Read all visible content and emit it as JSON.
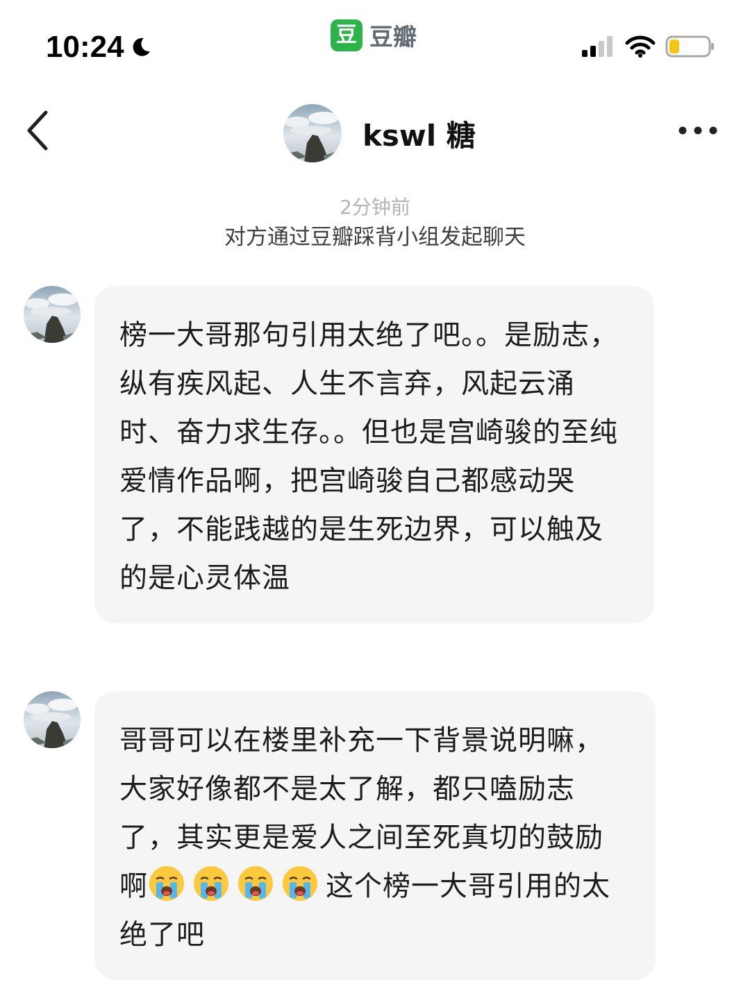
{
  "status_bar": {
    "time": "10:24",
    "app_logo_char": "豆",
    "app_name": "豆瓣",
    "icons": [
      "moon-icon",
      "signal-icon",
      "wifi-icon",
      "battery-icon"
    ],
    "battery_level": 0.25,
    "battery_color": "#f5c518"
  },
  "nav": {
    "title": "kswl 糖",
    "icons": [
      "back-arrow-icon",
      "more-icon"
    ]
  },
  "notice": {
    "time": "2分钟前",
    "text": "对方通过豆瓣踩背小组发起聊天"
  },
  "messages": [
    {
      "text": "榜一大哥那句引用太绝了吧。。是励志，纵有疾风起、人生不言弃，风起云涌时、奋力求生存。。但也是宫崎骏的至纯爱情作品啊，把宫崎骏自己都感动哭了，不能践越的是生死边界，可以触及的是心灵体温"
    },
    {
      "text_before": "哥哥可以在楼里补充一下背景说明嘛，大家好像都不是太了解，都只嗑励志了，其实更是爱人之间至死真切的鼓励啊",
      "emojis": [
        "loudly-crying-face-icon",
        "loudly-crying-face-icon",
        "loudly-crying-face-icon",
        "loudly-crying-face-icon"
      ],
      "text_after": "这个榜一大哥引用的太绝了吧"
    }
  ],
  "colors": {
    "brand_green": "#2db34a",
    "bubble_bg": "#f5f5f5"
  }
}
